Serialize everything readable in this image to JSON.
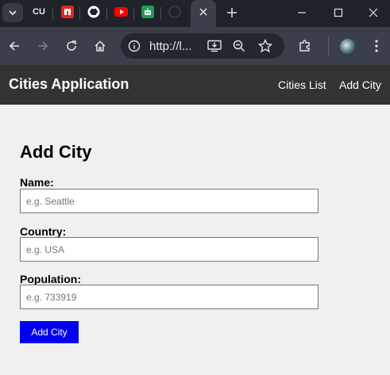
{
  "browser": {
    "tabs": [
      {
        "icon": "tab-search-menu-icon"
      },
      {
        "icon": "cu-favicon",
        "text": "CU"
      },
      {
        "icon": "red-n-favicon"
      },
      {
        "icon": "github-favicon"
      },
      {
        "icon": "youtube-favicon"
      },
      {
        "icon": "green-robot-favicon"
      },
      {
        "icon": "github-favicon-dim"
      },
      {
        "icon": "close-icon",
        "active": true
      }
    ],
    "url": "http://l..."
  },
  "app": {
    "brand": "Cities Application",
    "nav": {
      "cities_list": "Cities List",
      "add_city": "Add City"
    }
  },
  "form": {
    "title": "Add City",
    "name": {
      "label": "Name:",
      "placeholder": "e.g. Seattle",
      "value": ""
    },
    "country": {
      "label": "Country:",
      "placeholder": "e.g. USA",
      "value": ""
    },
    "population": {
      "label": "Population:",
      "placeholder": "e.g. 733919",
      "value": ""
    },
    "submit_label": "Add City"
  },
  "colors": {
    "navbar": "#333333",
    "page_bg": "#f0f0f0",
    "submit_bg": "#0000ee",
    "browser_dark": "#1f2229",
    "browser_toolbar": "#3a3f4a"
  }
}
